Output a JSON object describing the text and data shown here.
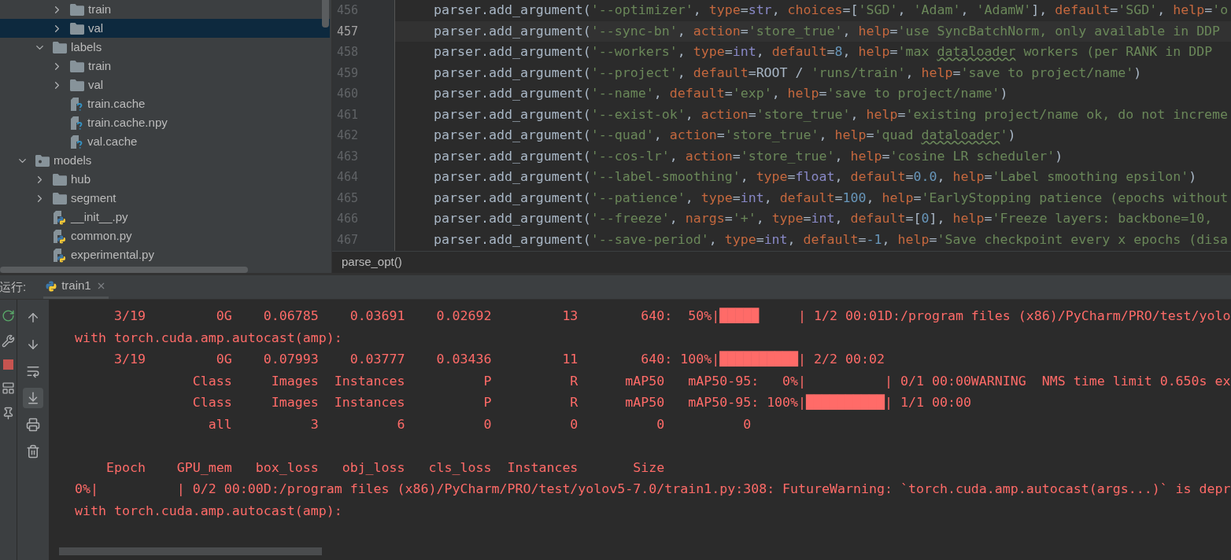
{
  "project_tree": [
    {
      "children": [
        {
          "children": [
            {
              "name": "train",
              "kind": "folder",
              "expanded": false,
              "selected": false
            },
            {
              "name": "val",
              "kind": "folder",
              "expanded": false,
              "selected": true
            }
          ]
        },
        {
          "name": "labels",
          "kind": "folder",
          "expanded": true,
          "selected": false,
          "children": [
            {
              "name": "train",
              "kind": "folder",
              "expanded": false,
              "selected": false
            },
            {
              "name": "val",
              "kind": "folder",
              "expanded": false,
              "selected": false
            },
            {
              "name": "train.cache",
              "kind": "unknown_file",
              "selected": false
            },
            {
              "name": "train.cache.npy",
              "kind": "unknown_file",
              "selected": false
            },
            {
              "name": "val.cache",
              "kind": "unknown_file",
              "selected": false
            }
          ]
        }
      ]
    },
    {
      "name": "models",
      "kind": "package",
      "expanded": true,
      "selected": false,
      "children": [
        {
          "name": "hub",
          "kind": "folder",
          "expanded": false,
          "selected": false
        },
        {
          "name": "segment",
          "kind": "folder",
          "expanded": false,
          "selected": false
        },
        {
          "name": "__init__.py",
          "kind": "python_file",
          "selected": false
        },
        {
          "name": "common.py",
          "kind": "python_file",
          "selected": false
        },
        {
          "name": "experimental.py",
          "kind": "python_file",
          "selected": false
        }
      ]
    }
  ],
  "editor": {
    "lines": [
      {
        "number": "456",
        "current": false,
        "tokens": [
          {
            "kind": "plain",
            "text": "parser.add_argument("
          },
          {
            "kind": "string",
            "text": "'--optimizer'"
          },
          {
            "kind": "plain",
            "text": ", "
          },
          {
            "kind": "keyword",
            "text": "type"
          },
          {
            "kind": "plain",
            "text": "="
          },
          {
            "kind": "builtin",
            "text": "str"
          },
          {
            "kind": "plain",
            "text": ", "
          },
          {
            "kind": "keyword",
            "text": "choices"
          },
          {
            "kind": "plain",
            "text": "=["
          },
          {
            "kind": "string",
            "text": "'SGD'"
          },
          {
            "kind": "plain",
            "text": ", "
          },
          {
            "kind": "string",
            "text": "'Adam'"
          },
          {
            "kind": "plain",
            "text": ", "
          },
          {
            "kind": "string",
            "text": "'AdamW'"
          },
          {
            "kind": "plain",
            "text": "], "
          },
          {
            "kind": "keyword",
            "text": "default"
          },
          {
            "kind": "plain",
            "text": "="
          },
          {
            "kind": "string",
            "text": "'SGD'"
          },
          {
            "kind": "plain",
            "text": ", "
          },
          {
            "kind": "keyword",
            "text": "help"
          },
          {
            "kind": "plain",
            "text": "="
          },
          {
            "kind": "string",
            "text": "'o"
          }
        ]
      },
      {
        "number": "457",
        "current": true,
        "tokens": [
          {
            "kind": "plain",
            "text": "parser.add_argument("
          },
          {
            "kind": "string",
            "text": "'--sync-bn'"
          },
          {
            "kind": "plain",
            "text": ", "
          },
          {
            "kind": "keyword",
            "text": "action"
          },
          {
            "kind": "plain",
            "text": "="
          },
          {
            "kind": "string",
            "text": "'store_true'"
          },
          {
            "kind": "plain",
            "text": ", "
          },
          {
            "kind": "keyword",
            "text": "help"
          },
          {
            "kind": "plain",
            "text": "="
          },
          {
            "kind": "string",
            "text": "'use SyncBatchNorm, only available in DDP"
          }
        ]
      },
      {
        "number": "458",
        "current": false,
        "tokens": [
          {
            "kind": "plain",
            "text": "parser.add_argument("
          },
          {
            "kind": "string",
            "text": "'--workers'"
          },
          {
            "kind": "plain",
            "text": ", "
          },
          {
            "kind": "keyword",
            "text": "type"
          },
          {
            "kind": "plain",
            "text": "="
          },
          {
            "kind": "builtin",
            "text": "int"
          },
          {
            "kind": "plain",
            "text": ", "
          },
          {
            "kind": "keyword",
            "text": "default"
          },
          {
            "kind": "plain",
            "text": "="
          },
          {
            "kind": "number",
            "text": "8"
          },
          {
            "kind": "plain",
            "text": ", "
          },
          {
            "kind": "keyword",
            "text": "help"
          },
          {
            "kind": "plain",
            "text": "="
          },
          {
            "kind": "string",
            "text": "'max "
          },
          {
            "kind": "typo",
            "text": "dataloader"
          },
          {
            "kind": "string",
            "text": " workers (per RANK in DDP"
          }
        ]
      },
      {
        "number": "459",
        "current": false,
        "tokens": [
          {
            "kind": "plain",
            "text": "parser.add_argument("
          },
          {
            "kind": "string",
            "text": "'--project'"
          },
          {
            "kind": "plain",
            "text": ", "
          },
          {
            "kind": "keyword",
            "text": "default"
          },
          {
            "kind": "plain",
            "text": "=ROOT / "
          },
          {
            "kind": "string",
            "text": "'runs/train'"
          },
          {
            "kind": "plain",
            "text": ", "
          },
          {
            "kind": "keyword",
            "text": "help"
          },
          {
            "kind": "plain",
            "text": "="
          },
          {
            "kind": "string",
            "text": "'save to project/name'"
          },
          {
            "kind": "plain",
            "text": ")"
          }
        ]
      },
      {
        "number": "460",
        "current": false,
        "tokens": [
          {
            "kind": "plain",
            "text": "parser.add_argument("
          },
          {
            "kind": "string",
            "text": "'--name'"
          },
          {
            "kind": "plain",
            "text": ", "
          },
          {
            "kind": "keyword",
            "text": "default"
          },
          {
            "kind": "plain",
            "text": "="
          },
          {
            "kind": "string",
            "text": "'exp'"
          },
          {
            "kind": "plain",
            "text": ", "
          },
          {
            "kind": "keyword",
            "text": "help"
          },
          {
            "kind": "plain",
            "text": "="
          },
          {
            "kind": "string",
            "text": "'save to project/name'"
          },
          {
            "kind": "plain",
            "text": ")"
          }
        ]
      },
      {
        "number": "461",
        "current": false,
        "tokens": [
          {
            "kind": "plain",
            "text": "parser.add_argument("
          },
          {
            "kind": "string",
            "text": "'--exist-ok'"
          },
          {
            "kind": "plain",
            "text": ", "
          },
          {
            "kind": "keyword",
            "text": "action"
          },
          {
            "kind": "plain",
            "text": "="
          },
          {
            "kind": "string",
            "text": "'store_true'"
          },
          {
            "kind": "plain",
            "text": ", "
          },
          {
            "kind": "keyword",
            "text": "help"
          },
          {
            "kind": "plain",
            "text": "="
          },
          {
            "kind": "string",
            "text": "'existing project/name ok, do not increme"
          }
        ]
      },
      {
        "number": "462",
        "current": false,
        "tokens": [
          {
            "kind": "plain",
            "text": "parser.add_argument("
          },
          {
            "kind": "string",
            "text": "'--quad'"
          },
          {
            "kind": "plain",
            "text": ", "
          },
          {
            "kind": "keyword",
            "text": "action"
          },
          {
            "kind": "plain",
            "text": "="
          },
          {
            "kind": "string",
            "text": "'store_true'"
          },
          {
            "kind": "plain",
            "text": ", "
          },
          {
            "kind": "keyword",
            "text": "help"
          },
          {
            "kind": "plain",
            "text": "="
          },
          {
            "kind": "string",
            "text": "'quad "
          },
          {
            "kind": "typo",
            "text": "dataloader"
          },
          {
            "kind": "string",
            "text": "'"
          },
          {
            "kind": "plain",
            "text": ")"
          }
        ]
      },
      {
        "number": "463",
        "current": false,
        "tokens": [
          {
            "kind": "plain",
            "text": "parser.add_argument("
          },
          {
            "kind": "string",
            "text": "'--cos-lr'"
          },
          {
            "kind": "plain",
            "text": ", "
          },
          {
            "kind": "keyword",
            "text": "action"
          },
          {
            "kind": "plain",
            "text": "="
          },
          {
            "kind": "string",
            "text": "'store_true'"
          },
          {
            "kind": "plain",
            "text": ", "
          },
          {
            "kind": "keyword",
            "text": "help"
          },
          {
            "kind": "plain",
            "text": "="
          },
          {
            "kind": "string",
            "text": "'cosine LR scheduler'"
          },
          {
            "kind": "plain",
            "text": ")"
          }
        ]
      },
      {
        "number": "464",
        "current": false,
        "tokens": [
          {
            "kind": "plain",
            "text": "parser.add_argument("
          },
          {
            "kind": "string",
            "text": "'--label-smoothing'"
          },
          {
            "kind": "plain",
            "text": ", "
          },
          {
            "kind": "keyword",
            "text": "type"
          },
          {
            "kind": "plain",
            "text": "="
          },
          {
            "kind": "builtin",
            "text": "float"
          },
          {
            "kind": "plain",
            "text": ", "
          },
          {
            "kind": "keyword",
            "text": "default"
          },
          {
            "kind": "plain",
            "text": "="
          },
          {
            "kind": "number",
            "text": "0.0"
          },
          {
            "kind": "plain",
            "text": ", "
          },
          {
            "kind": "keyword",
            "text": "help"
          },
          {
            "kind": "plain",
            "text": "="
          },
          {
            "kind": "string",
            "text": "'Label smoothing epsilon'"
          },
          {
            "kind": "plain",
            "text": ")"
          }
        ]
      },
      {
        "number": "465",
        "current": false,
        "tokens": [
          {
            "kind": "plain",
            "text": "parser.add_argument("
          },
          {
            "kind": "string",
            "text": "'--patience'"
          },
          {
            "kind": "plain",
            "text": ", "
          },
          {
            "kind": "keyword",
            "text": "type"
          },
          {
            "kind": "plain",
            "text": "="
          },
          {
            "kind": "builtin",
            "text": "int"
          },
          {
            "kind": "plain",
            "text": ", "
          },
          {
            "kind": "keyword",
            "text": "default"
          },
          {
            "kind": "plain",
            "text": "="
          },
          {
            "kind": "number",
            "text": "100"
          },
          {
            "kind": "plain",
            "text": ", "
          },
          {
            "kind": "keyword",
            "text": "help"
          },
          {
            "kind": "plain",
            "text": "="
          },
          {
            "kind": "string",
            "text": "'EarlyStopping patience (epochs without"
          }
        ]
      },
      {
        "number": "466",
        "current": false,
        "tokens": [
          {
            "kind": "plain",
            "text": "parser.add_argument("
          },
          {
            "kind": "string",
            "text": "'--freeze'"
          },
          {
            "kind": "plain",
            "text": ", "
          },
          {
            "kind": "keyword",
            "text": "nargs"
          },
          {
            "kind": "plain",
            "text": "="
          },
          {
            "kind": "string",
            "text": "'+'"
          },
          {
            "kind": "plain",
            "text": ", "
          },
          {
            "kind": "keyword",
            "text": "type"
          },
          {
            "kind": "plain",
            "text": "="
          },
          {
            "kind": "builtin",
            "text": "int"
          },
          {
            "kind": "plain",
            "text": ", "
          },
          {
            "kind": "keyword",
            "text": "default"
          },
          {
            "kind": "plain",
            "text": "=["
          },
          {
            "kind": "number",
            "text": "0"
          },
          {
            "kind": "plain",
            "text": "], "
          },
          {
            "kind": "keyword",
            "text": "help"
          },
          {
            "kind": "plain",
            "text": "="
          },
          {
            "kind": "string",
            "text": "'Freeze layers: backbone=10,"
          }
        ]
      },
      {
        "number": "467",
        "current": false,
        "tokens": [
          {
            "kind": "plain",
            "text": "parser.add_argument("
          },
          {
            "kind": "string",
            "text": "'--save-period'"
          },
          {
            "kind": "plain",
            "text": ", "
          },
          {
            "kind": "keyword",
            "text": "type"
          },
          {
            "kind": "plain",
            "text": "="
          },
          {
            "kind": "builtin",
            "text": "int"
          },
          {
            "kind": "plain",
            "text": ", "
          },
          {
            "kind": "keyword",
            "text": "default"
          },
          {
            "kind": "plain",
            "text": "="
          },
          {
            "kind": "number",
            "text": "-1"
          },
          {
            "kind": "plain",
            "text": ", "
          },
          {
            "kind": "keyword",
            "text": "help"
          },
          {
            "kind": "plain",
            "text": "="
          },
          {
            "kind": "string",
            "text": "'Save checkpoint every x epochs (disa"
          }
        ]
      }
    ],
    "breadcrumb": "parse_opt()"
  },
  "run_panel": {
    "label": "运行:",
    "tabs": [
      {
        "title": "train1",
        "selected": true
      }
    ],
    "side_tools": [
      {
        "kind": "rerun"
      },
      {
        "kind": "settings"
      },
      {
        "kind": "stop"
      },
      {
        "kind": "layout"
      },
      {
        "kind": "pin"
      }
    ],
    "console_tools": [
      {
        "kind": "up",
        "on": false
      },
      {
        "kind": "down",
        "on": false
      },
      {
        "kind": "wrap",
        "on": false
      },
      {
        "kind": "scroll_end",
        "on": true
      },
      {
        "kind": "print",
        "on": false
      },
      {
        "kind": "clear",
        "on": false
      }
    ],
    "console": [
      {
        "text": "       3/19         0G    0.06785    0.03691    0.02692         13        640:  50%|█████     | 1/2 00:01D:/program files (x86)/PyCharm/PRO/test/yolo",
        "space_before": false
      },
      {
        "text": "  with torch.cuda.amp.autocast(amp):",
        "space_before": false
      },
      {
        "text": "       3/19         0G    0.07993    0.03777    0.03436         11        640: 100%|██████████| 2/2 00:02",
        "space_before": false
      },
      {
        "text": "                 Class     Images  Instances          P          R      mAP50   mAP50-95:   0%|          | 0/1 00:00WARNING  NMS time limit 0.650s ex",
        "space_before": false
      },
      {
        "text": "                 Class     Images  Instances          P          R      mAP50   mAP50-95: 100%|██████████| 1/1 00:00",
        "space_before": false
      },
      {
        "text": "                   all          3          6          0          0          0          0",
        "space_before": false
      },
      {
        "text": "      Epoch    GPU_mem   box_loss   obj_loss   cls_loss  Instances       Size",
        "space_before": true
      },
      {
        "text": "  0%|          | 0/2 00:00D:/program files (x86)/PyCharm/PRO/test/yolov5-7.0/train1.py:308: FutureWarning: `torch.cuda.amp.autocast(args...)` is depr",
        "space_before": false
      },
      {
        "text": "  with torch.cuda.amp.autocast(amp):",
        "space_before": false
      }
    ]
  }
}
